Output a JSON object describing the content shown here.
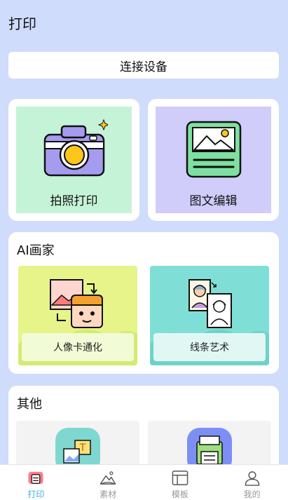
{
  "header": {
    "title": "打印"
  },
  "connect": {
    "label": "连接设备"
  },
  "main_cards": [
    {
      "label": "拍照打印",
      "icon": "camera-icon"
    },
    {
      "label": "图文编辑",
      "icon": "image-text-icon"
    }
  ],
  "ai_section": {
    "title": "AI画家",
    "tiles": [
      {
        "label": "人像卡通化",
        "icon": "cartoon-portrait-icon"
      },
      {
        "label": "线条艺术",
        "icon": "line-art-icon"
      }
    ]
  },
  "other_section": {
    "title": "其他"
  },
  "tabbar": {
    "items": [
      {
        "label": "打印",
        "icon": "printer-icon",
        "active": true
      },
      {
        "label": "素材",
        "icon": "mountain-icon",
        "active": false
      },
      {
        "label": "模板",
        "icon": "template-icon",
        "active": false
      },
      {
        "label": "我的",
        "icon": "user-icon",
        "active": false
      }
    ]
  },
  "colors": {
    "accent": "#3ab0e8",
    "background": "#cfdcfb"
  }
}
